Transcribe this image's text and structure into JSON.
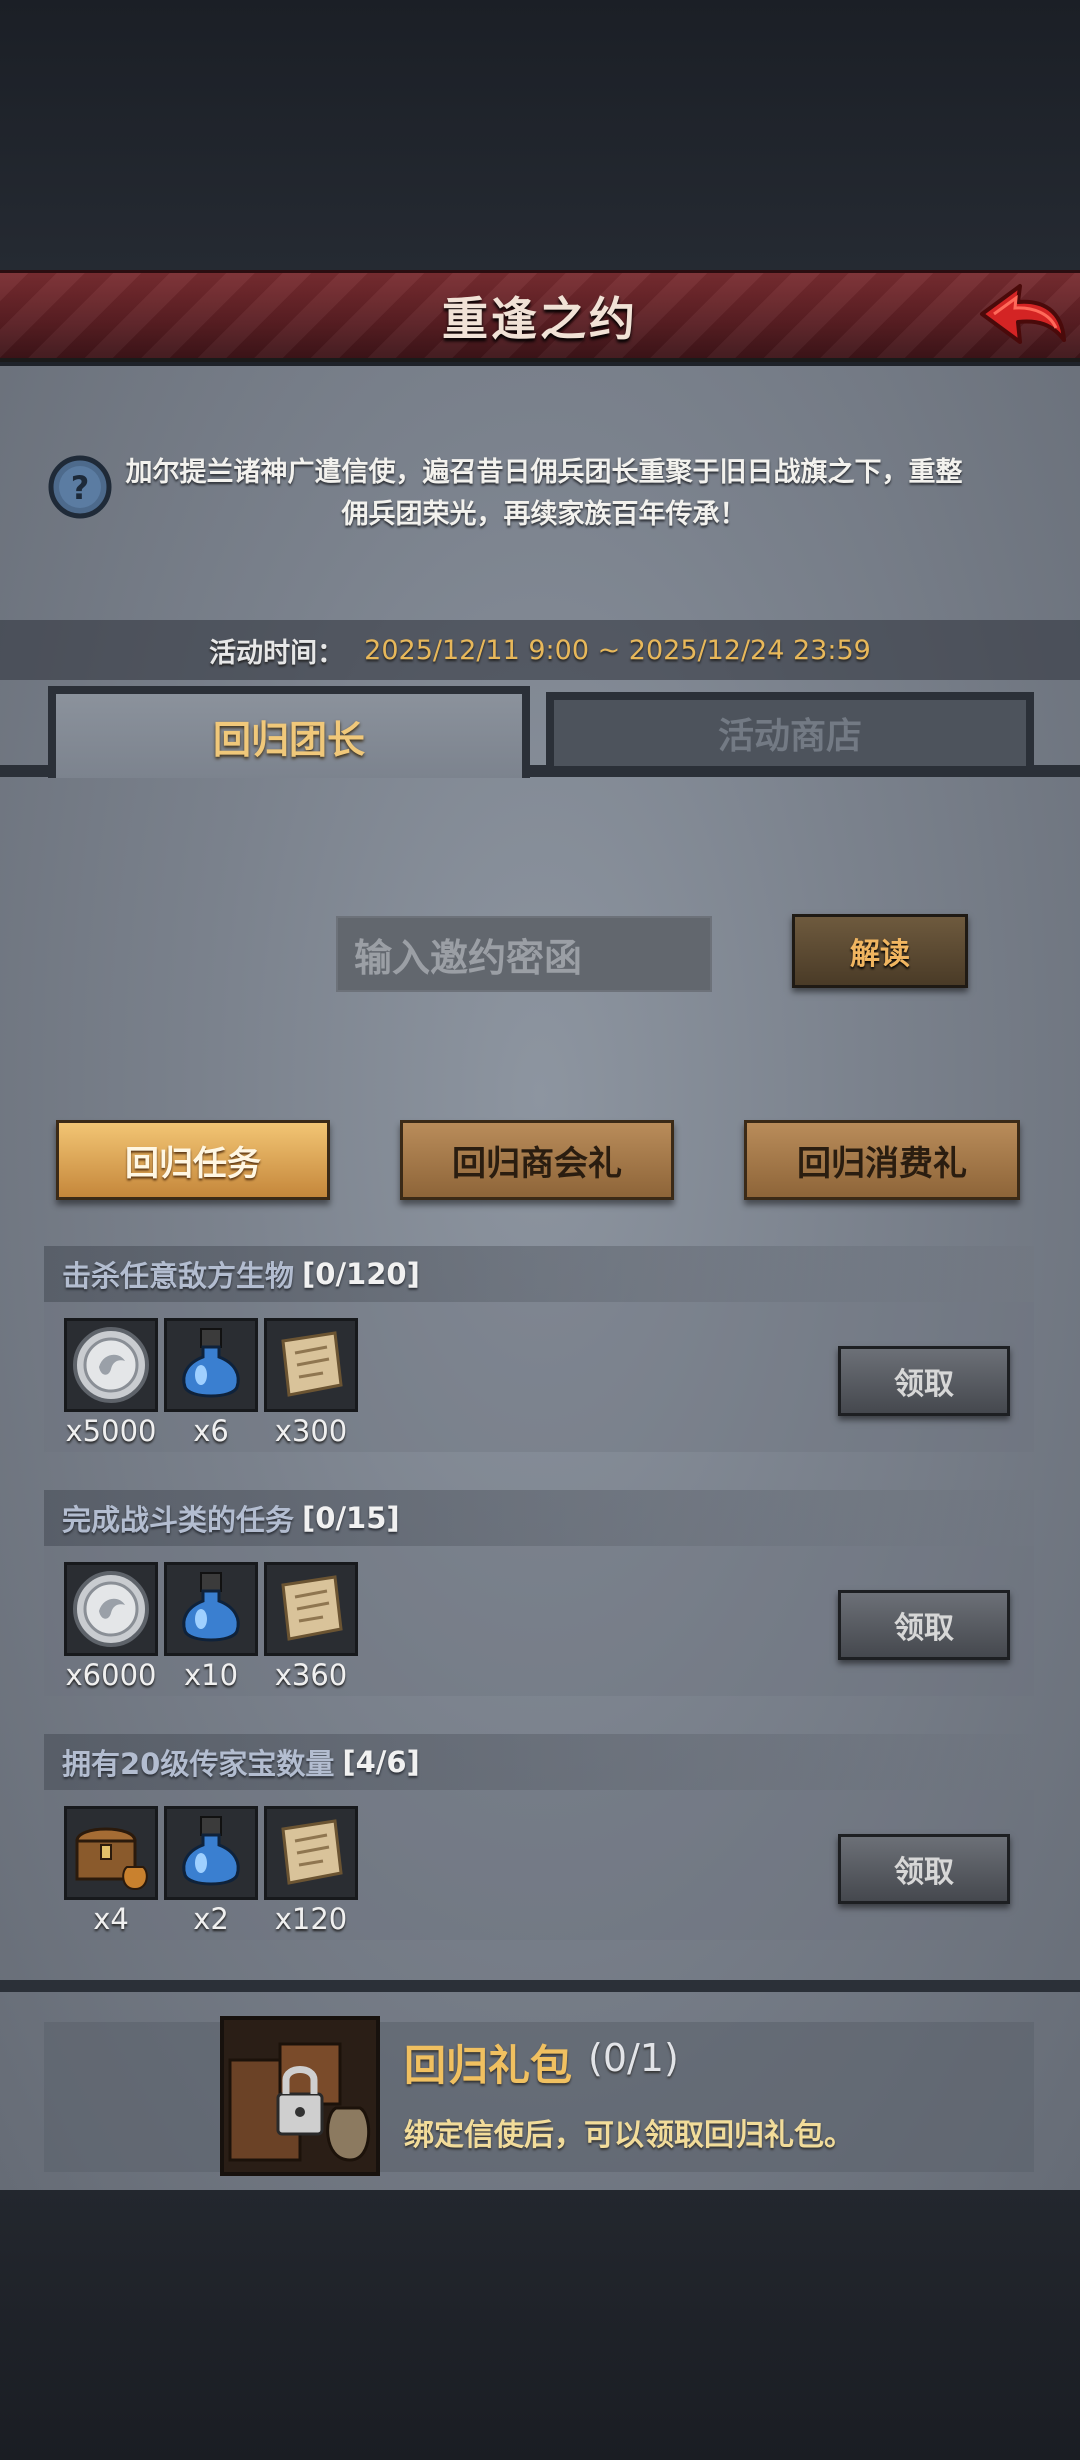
{
  "header": {
    "title": "重逢之约"
  },
  "description": "加尔提兰诸神广遣信使，遍召昔日佣兵团长重聚于旧日战旗之下，重整佣兵团荣光，再续家族百年传承！",
  "event_time": {
    "label": "活动时间：",
    "value": "2025/12/11 9:00 ~ 2025/12/24 23:59"
  },
  "tabs": [
    {
      "label": "回归团长",
      "active": true
    },
    {
      "label": "活动商店",
      "active": false
    }
  ],
  "invite": {
    "placeholder": "输入邀约密函",
    "button_label": "解读"
  },
  "categories": [
    {
      "label": "回归任务",
      "active": true
    },
    {
      "label": "回归商会礼",
      "active": false
    },
    {
      "label": "回归消费礼",
      "active": false
    }
  ],
  "tasks": [
    {
      "title": "击杀任意敌方生物",
      "progress": "[0/120]",
      "rewards": [
        {
          "icon": "silver-coin-icon",
          "count": "x5000"
        },
        {
          "icon": "blue-potion-icon",
          "count": "x6"
        },
        {
          "icon": "scroll-icon",
          "count": "x300"
        }
      ],
      "claim_label": "领取"
    },
    {
      "title": "完成战斗类的任务",
      "progress": "[0/15]",
      "rewards": [
        {
          "icon": "silver-coin-icon",
          "count": "x6000"
        },
        {
          "icon": "blue-potion-icon",
          "count": "x10"
        },
        {
          "icon": "scroll-icon",
          "count": "x360"
        }
      ],
      "claim_label": "领取"
    },
    {
      "title": "拥有20级传家宝数量",
      "progress": "[4/6]",
      "rewards": [
        {
          "icon": "treasure-chest-icon",
          "count": "x4"
        },
        {
          "icon": "blue-potion-icon",
          "count": "x2"
        },
        {
          "icon": "scroll-icon",
          "count": "x120"
        }
      ],
      "claim_label": "领取"
    }
  ],
  "gift": {
    "title": "回归礼包",
    "count": "(0/1)",
    "description": "绑定信使后，可以领取回归礼包。",
    "icon": "locked-crate-icon"
  },
  "colors": {
    "accent_gold": "#f0c060",
    "title_bar_red": "#6a2429",
    "time_value": "#e8b85a"
  }
}
